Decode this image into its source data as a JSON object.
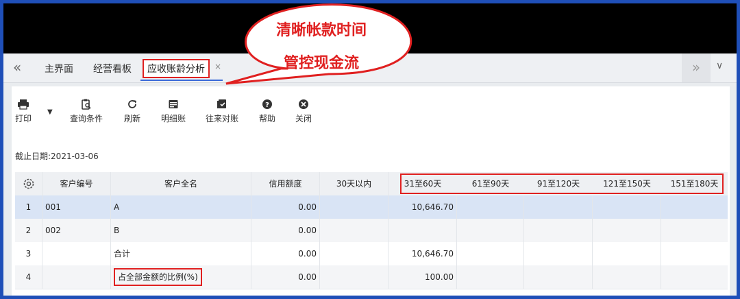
{
  "callout": {
    "line1": "清晰帐款时间",
    "line2": "管控现金流"
  },
  "tabs": {
    "nav_left": "«",
    "items": [
      {
        "label": "主界面"
      },
      {
        "label": "经营看板"
      },
      {
        "label": "应收账龄分析",
        "active": true
      }
    ],
    "close": "×",
    "nav_right": "»",
    "dropdown": "∨"
  },
  "toolbar": {
    "print": "打印",
    "print_dropdown": "▼",
    "query": "查询条件",
    "refresh": "刷新",
    "detail": "明细账",
    "recon": "往来对账",
    "help": "帮助",
    "close": "关闭"
  },
  "cutoff": "截止日期:2021-03-06",
  "grid": {
    "headers": {
      "code": "客户编号",
      "name": "客户全名",
      "credit": "信用额度",
      "d30": "30天以内",
      "d31_60": "31至60天",
      "d61_90": "61至90天",
      "d91_120": "91至120天",
      "d121_150": "121至150天",
      "d151_180": "151至180天"
    },
    "rows": [
      {
        "no": "1",
        "code": "001",
        "name": "A",
        "credit": "0.00",
        "d30": "",
        "d31_60": "10,646.70"
      },
      {
        "no": "2",
        "code": "002",
        "name": "B",
        "credit": "0.00",
        "d30": "",
        "d31_60": ""
      },
      {
        "no": "3",
        "code": "",
        "name": "合计",
        "credit": "0.00",
        "d30": "",
        "d31_60": "10,646.70"
      },
      {
        "no": "4",
        "code": "",
        "name": "占全部金额的比例(%)",
        "credit": "0.00",
        "d30": "",
        "d31_60": "100.00"
      }
    ]
  },
  "colors": {
    "highlight": "#e02020",
    "selected_row": "#d9e4f5",
    "frame": "#1f4fb8"
  }
}
